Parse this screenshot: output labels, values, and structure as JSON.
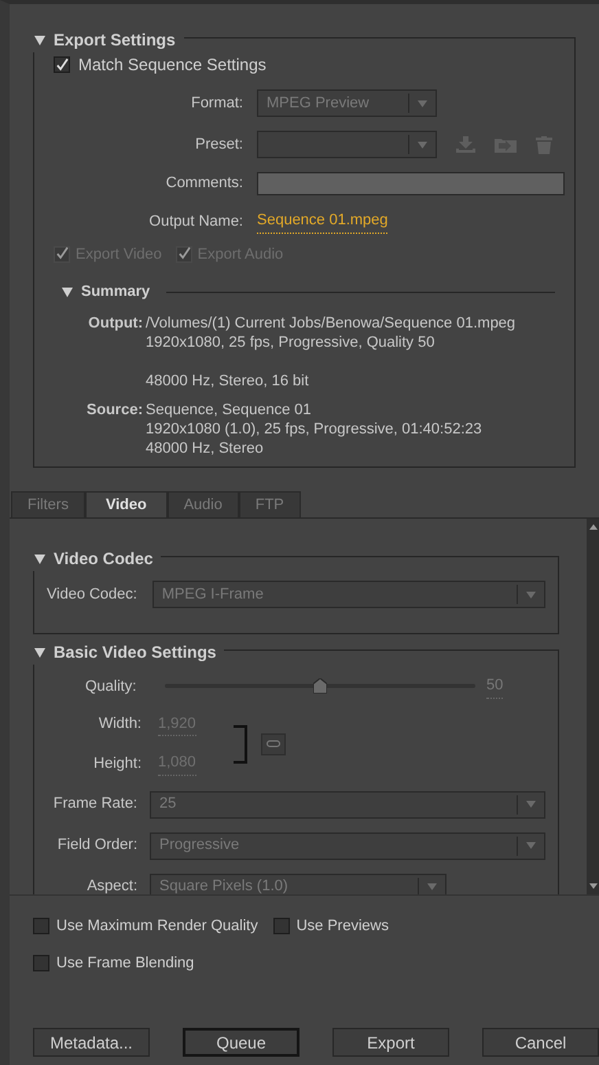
{
  "export_settings": {
    "title": "Export Settings",
    "expanded": true,
    "match_sequence": {
      "label": "Match Sequence Settings",
      "checked": true
    },
    "format": {
      "label": "Format:",
      "value": "MPEG Preview",
      "disabled": true
    },
    "preset": {
      "label": "Preset:",
      "disabled": true
    },
    "comments": {
      "label": "Comments:"
    },
    "output_name": {
      "label": "Output Name:",
      "value": "Sequence 01.mpeg"
    },
    "export_toggles": [
      {
        "label": "Export Video",
        "checked": true,
        "disabled": true
      },
      {
        "label": "Export Audio",
        "checked": true,
        "disabled": true
      }
    ],
    "summary": {
      "title": "Summary",
      "expanded": true,
      "groups": [
        {
          "label": "Output:",
          "lines": [
            {
              "text": "/Volumes/(1) Current Jobs/Benowa/Sequence 01.mpeg",
              "gap_before": false
            },
            {
              "text": "1920x1080, 25 fps, Progressive, Quality 50",
              "gap_before": false
            },
            {
              "text": "48000 Hz, Stereo, 16 bit",
              "gap_before": true
            }
          ]
        },
        {
          "label": "Source:",
          "lines": [
            {
              "text": "Sequence, Sequence 01",
              "gap_before": false
            },
            {
              "text": "1920x1080 (1.0), 25 fps, Progressive, 01:40:52:23",
              "gap_before": false
            },
            {
              "text": "48000 Hz, Stereo",
              "gap_before": false
            }
          ]
        }
      ]
    }
  },
  "tabs": [
    {
      "label": "Filters",
      "selected": false
    },
    {
      "label": "Video",
      "selected": true
    },
    {
      "label": "Audio",
      "selected": false
    },
    {
      "label": "FTP",
      "selected": false
    }
  ],
  "video_codec": {
    "title": "Video Codec",
    "expanded": true,
    "label": "Video Codec:",
    "value": "MPEG I-Frame",
    "disabled": true
  },
  "basic_video": {
    "title": "Basic Video Settings",
    "expanded": true,
    "quality": {
      "label": "Quality:",
      "level": 0.5,
      "reading": "50"
    },
    "width": {
      "label": "Width:",
      "value": "1,920"
    },
    "height": {
      "label": "Height:",
      "value": "1,080"
    },
    "dropdowns": [
      {
        "label": "Frame Rate:",
        "value": "25",
        "wide": true
      },
      {
        "label": "Field Order:",
        "value": "Progressive",
        "wide": true
      },
      {
        "label": "Aspect:",
        "value": "Square Pixels (1.0)",
        "wide": false
      }
    ]
  },
  "options": [
    {
      "label": "Use Maximum Render Quality",
      "checked": false
    },
    {
      "label": "Use Previews",
      "checked": false
    },
    {
      "label": "Use Frame Blending",
      "checked": false
    }
  ],
  "buttons": [
    {
      "label": "Metadata...",
      "default": false
    },
    {
      "label": "Queue",
      "default": true
    },
    {
      "label": "Export",
      "default": false
    },
    {
      "label": "Cancel",
      "default": false
    }
  ]
}
